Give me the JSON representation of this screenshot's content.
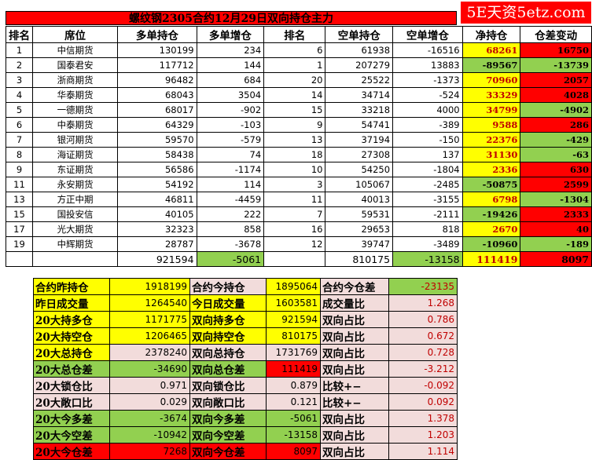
{
  "title": "螺纹钢2305合约12月29日双向持仓主力",
  "logo": "5E天资5etz.com",
  "headers": [
    "排名",
    "席位",
    "多单持仓",
    "多单增仓",
    "排名",
    "空单持仓",
    "空单增仓",
    "净持仓",
    "仓差变动"
  ],
  "rows": [
    [
      "1",
      "中信期货",
      "130199",
      "234",
      "6",
      "61938",
      "-16516",
      "68261",
      "16750"
    ],
    [
      "2",
      "国泰君安",
      "117712",
      "144",
      "1",
      "207279",
      "13883",
      "-89567",
      "-13739"
    ],
    [
      "3",
      "浙商期货",
      "96482",
      "684",
      "20",
      "25522",
      "-1373",
      "70960",
      "2057"
    ],
    [
      "4",
      "华泰期货",
      "68043",
      "3504",
      "14",
      "34714",
      "-524",
      "33329",
      "4028"
    ],
    [
      "5",
      "一德期货",
      "68017",
      "-902",
      "15",
      "33218",
      "4000",
      "34799",
      "-4902"
    ],
    [
      "6",
      "中泰期货",
      "64329",
      "-103",
      "9",
      "54741",
      "-389",
      "9588",
      "286"
    ],
    [
      "7",
      "银河期货",
      "59570",
      "-579",
      "13",
      "37194",
      "-150",
      "22376",
      "-429"
    ],
    [
      "8",
      "海证期货",
      "58438",
      "74",
      "18",
      "27308",
      "137",
      "31130",
      "-63"
    ],
    [
      "9",
      "东证期货",
      "56586",
      "-1174",
      "10",
      "54250",
      "-1804",
      "2336",
      "630"
    ],
    [
      "11",
      "永安期货",
      "54192",
      "114",
      "3",
      "105067",
      "-2485",
      "-50875",
      "2599"
    ],
    [
      "13",
      "方正中期",
      "46811",
      "-4459",
      "11",
      "40013",
      "-3155",
      "6798",
      "-1304"
    ],
    [
      "15",
      "国投安信",
      "40105",
      "222",
      "7",
      "59531",
      "-2111",
      "-19426",
      "2333"
    ],
    [
      "17",
      "光大期货",
      "32323",
      "858",
      "16",
      "29653",
      "818",
      "2670",
      "40"
    ],
    [
      "19",
      "中辉期货",
      "28787",
      "-3678",
      "12",
      "39747",
      "-3489",
      "-10960",
      "-189"
    ]
  ],
  "totals": [
    "921594",
    "-5061",
    "810175",
    "-13158",
    "111419",
    "8097"
  ],
  "stats": [
    [
      "合约昨持仓",
      "1918199",
      "合约今持仓",
      "1895064",
      "合约今仓差",
      "-23135"
    ],
    [
      "昨日成交量",
      "1264540",
      "今日成交量",
      "1603581",
      "成交量比",
      "1.268"
    ],
    [
      "20大持多仓",
      "1171775",
      "双向持多仓",
      "921594",
      "双向占比",
      "0.786"
    ],
    [
      "20大持空仓",
      "1206465",
      "双向持空仓",
      "810175",
      "双向占比",
      "0.672"
    ],
    [
      "20大总持仓",
      "2378240",
      "双向总持仓",
      "1731769",
      "双向占比",
      "0.728"
    ],
    [
      "20大总仓差",
      "-34690",
      "双向总仓差",
      "111419",
      "双向占比",
      "-3.212"
    ],
    [
      "20大锁仓比",
      "0.971",
      "双向锁仓比",
      "0.879",
      "比较+−",
      "-0.092"
    ],
    [
      "20大敞口比",
      "0.029",
      "双向敞口比",
      "0.121",
      "比较+−",
      "0.092"
    ],
    [
      "20大今多差",
      "-3674",
      "双向今多差",
      "-5061",
      "双向占比",
      "1.378"
    ],
    [
      "20大今空差",
      "-10942",
      "双向今空差",
      "-13158",
      "双向占比",
      "1.203"
    ],
    [
      "20大今仓差",
      "7268",
      "双向今仓差",
      "8097",
      "双向占比",
      "1.114"
    ]
  ],
  "colors": {
    "yellow": "#ffff00",
    "green": "#92d050",
    "red": "#ff0000",
    "pink": "#f2dcdb"
  }
}
